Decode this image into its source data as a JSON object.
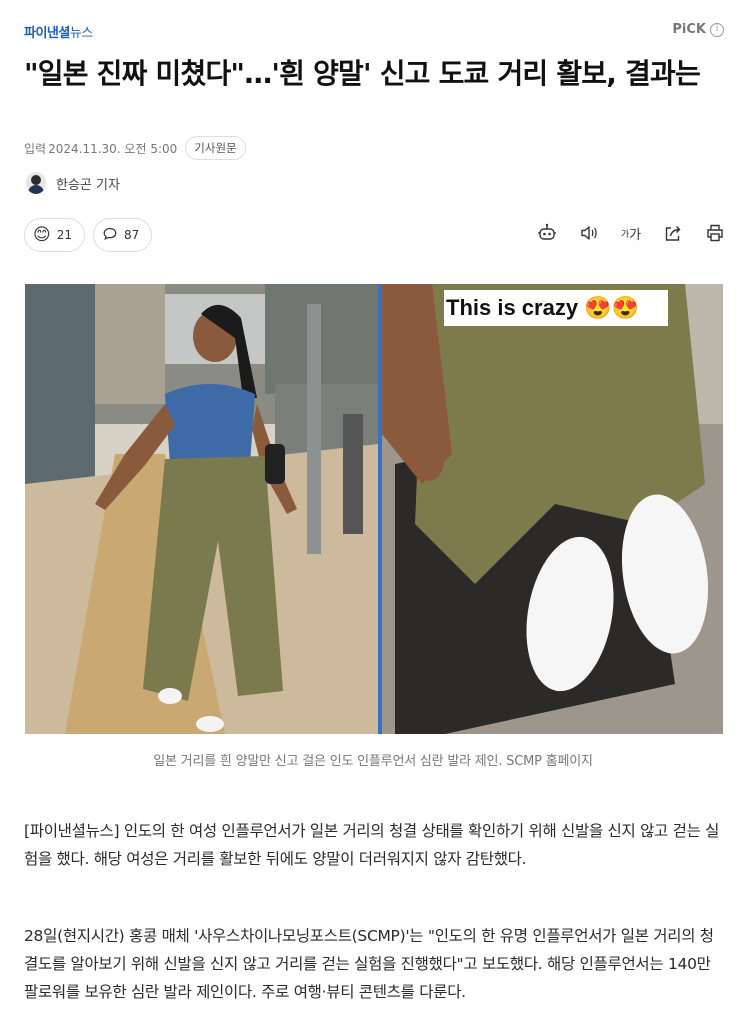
{
  "brand": {
    "name": "파이낸셜",
    "sub": "뉴스"
  },
  "pick": {
    "label": "PiCK",
    "info_icon": "info-icon"
  },
  "headline": "\"일본 진짜 미쳤다\"…'흰 양말' 신고 도쿄 거리 활보, 결과는",
  "meta": {
    "label": "입력",
    "datetime": "2024.11.30. 오전 5:00",
    "original_button": "기사원문"
  },
  "reporter": {
    "name": "한승곤 기자"
  },
  "reactions": {
    "emotion_count": "21",
    "comment_count": "87"
  },
  "tools": [
    "robot-summary-icon",
    "speaker-icon",
    "font-size-icon",
    "share-icon",
    "print-icon"
  ],
  "font_tool_label": "가",
  "photo": {
    "overlay_text": "This is crazy 😍😍"
  },
  "caption": "일본 거리를 흰 양말만 신고 걸은 인도 인플루언서 심란 발라 제인. SCMP 홈페이지",
  "body": {
    "p1": "[파이낸셜뉴스] 인도의 한 여성 인플루언서가 일본 거리의 청결 상태를 확인하기 위해 신발을 신지 않고 걷는 실험을 했다. 해당 여성은 거리를 활보한 뒤에도 양말이 더러워지지 않자 감탄했다.",
    "p2": "28일(현지시간) 홍콩 매체 '사우스차이나모닝포스트(SCMP)'는 \"인도의 한 유명 인플루언서가 일본 거리의 청결도를 알아보기 위해 신발을 신지 않고 거리를 걷는 실험을 진행했다\"고 보도했다. 해당 인플루언서는 140만 팔로워를 보유한 심란 발라 제인이다. 주로 여행·뷰티 콘텐츠를 다룬다."
  },
  "colors": {
    "brand": "#1a5fb4",
    "text": "#222222",
    "muted": "#777777"
  }
}
